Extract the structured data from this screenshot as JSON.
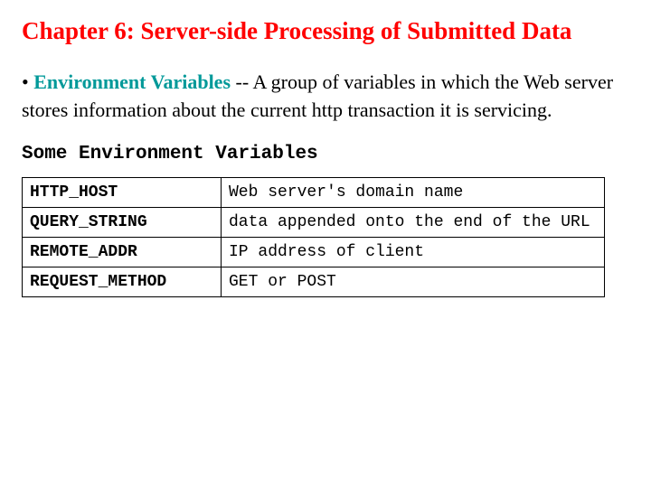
{
  "heading": "Chapter 6: Server-side Processing of Submitted Data",
  "definition": {
    "bullet": "•",
    "term": "Environment Variables",
    "rest": " -- A group of variables in which the Web server stores information about the current http transaction it is servicing."
  },
  "subheading": "Some Environment Variables",
  "table": {
    "rows": [
      {
        "name": "HTTP_HOST",
        "desc": "Web server's domain name"
      },
      {
        "name": "QUERY_STRING",
        "desc": "data appended onto the end of the URL"
      },
      {
        "name": "REMOTE_ADDR",
        "desc": "IP address of client"
      },
      {
        "name": "REQUEST_METHOD",
        "desc": "GET or POST"
      }
    ]
  }
}
